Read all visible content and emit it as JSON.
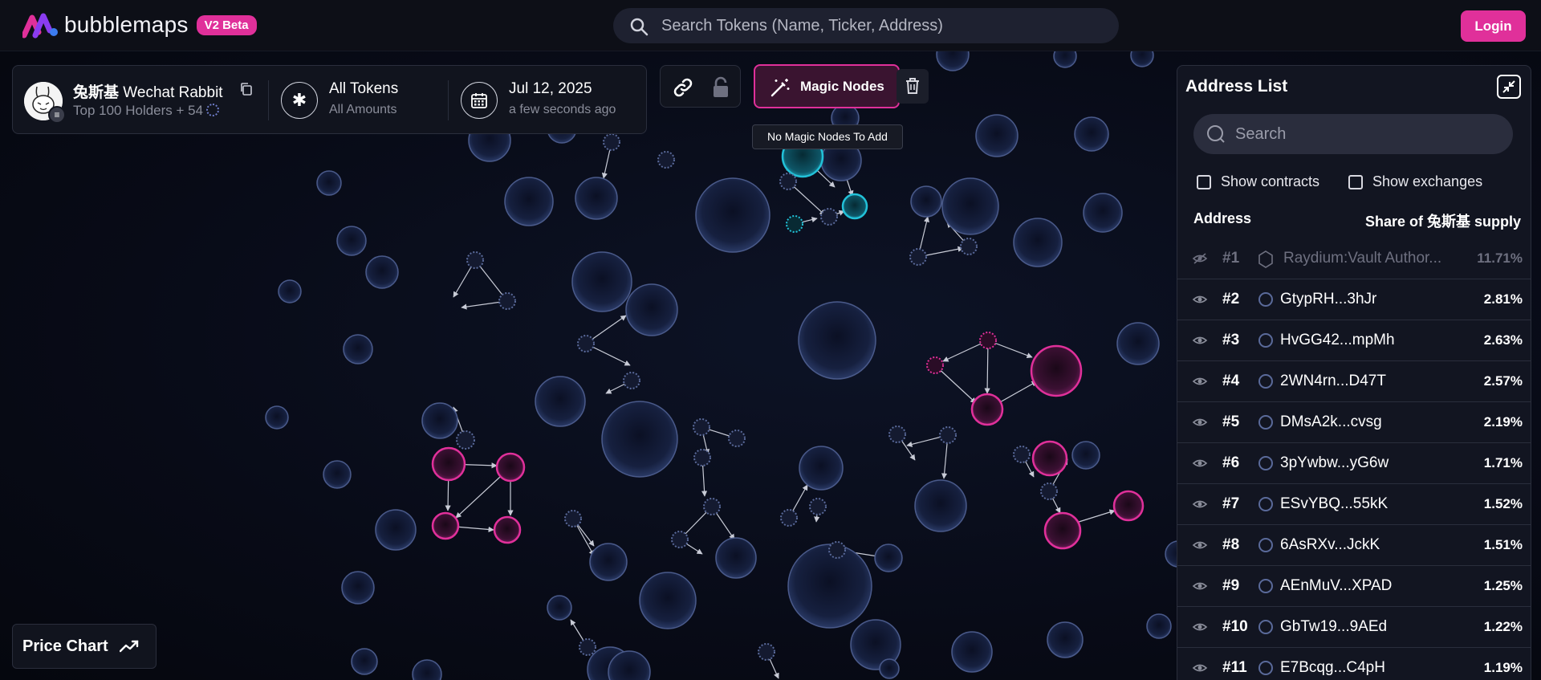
{
  "app": {
    "logo_text": "bubblemaps",
    "beta_badge": "V2 Beta",
    "search_placeholder": "Search Tokens (Name, Ticker, Address)",
    "login_label": "Login",
    "brand_color": "#e0309a"
  },
  "token": {
    "name_cn": "兔斯基",
    "name_en": "Wechat Rabbit",
    "holders_label": "Top 100 Holders + 54",
    "filter_title": "All Tokens",
    "filter_sub": "All Amounts",
    "date_title": "Jul 12, 2025",
    "date_sub": "a few seconds ago",
    "icons": [
      "copy-icon",
      "asterisk-icon",
      "calendar-icon",
      "spinner-icon"
    ]
  },
  "toolbar": {
    "magic_label": "Magic Nodes",
    "tooltip": "No Magic Nodes To Add",
    "icons": [
      "link-icon",
      "lock-icon",
      "magic-wand-icon",
      "trash-icon"
    ]
  },
  "address_list": {
    "title": "Address List",
    "search_placeholder": "Search",
    "show_contracts": "Show contracts",
    "show_exchanges": "Show exchanges",
    "col_address": "Address",
    "col_share": "Share of 兔斯基 supply",
    "rows": [
      {
        "rank": "#1",
        "address": "Raydium:Vault Author...",
        "share": "11.71%",
        "hidden": true
      },
      {
        "rank": "#2",
        "address": "GtypRH...3hJr",
        "share": "2.81%"
      },
      {
        "rank": "#3",
        "address": "HvGG42...mpMh",
        "share": "2.63%"
      },
      {
        "rank": "#4",
        "address": "2WN4rn...D47T",
        "share": "2.57%"
      },
      {
        "rank": "#5",
        "address": "DMsA2k...cvsg",
        "share": "2.19%"
      },
      {
        "rank": "#6",
        "address": "3pYwbw...yG6w",
        "share": "1.71%"
      },
      {
        "rank": "#7",
        "address": "ESvYBQ...55kK",
        "share": "1.52%"
      },
      {
        "rank": "#8",
        "address": "6AsRXv...JckK",
        "share": "1.51%"
      },
      {
        "rank": "#9",
        "address": "AEnMuV...XPAD",
        "share": "1.25%"
      },
      {
        "rank": "#10",
        "address": "GbTw19...9AEd",
        "share": "1.22%"
      },
      {
        "rank": "#11",
        "address": "E7Bcqg...C4pH",
        "share": "1.19%"
      }
    ]
  },
  "price_chart": {
    "label": "Price Chart",
    "icon": "trend-line-icon"
  },
  "bubble_colors": {
    "default": "#5a6a9a",
    "pink": "#e0309a",
    "cyan": "#22c1d8"
  }
}
